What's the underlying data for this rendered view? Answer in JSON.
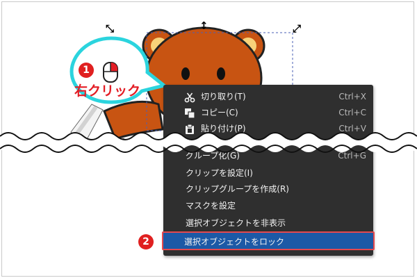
{
  "annotation": {
    "step1": "1",
    "step1_label": "右クリック",
    "step2": "2",
    "mouse_icon": "mouse-right-click-icon"
  },
  "colors": {
    "menu_bg": "#2f2f2f",
    "highlight": "#1c59a6",
    "accent_red": "#e31c24",
    "callout_cyan": "#2bd4de",
    "bear_brown": "#c85412"
  },
  "menu": {
    "items": [
      {
        "label": "切り取り(T)",
        "shortcut": "Ctrl+X",
        "icon": "scissors-icon"
      },
      {
        "label": "コピー(C)",
        "shortcut": "Ctrl+C",
        "icon": "copy-icon"
      },
      {
        "label": "貼り付け(P)",
        "shortcut": "Ctrl+V",
        "icon": "paste-icon"
      },
      {
        "label": "グループ化(G)",
        "shortcut": "Ctrl+G"
      },
      {
        "label": "クリップを設定(I)"
      },
      {
        "label": "クリップグループを作成(R)"
      },
      {
        "label": "マスクを設定"
      },
      {
        "label": "選択オブジェクトを非表示"
      },
      {
        "label": "選択オブジェクトをロック",
        "selected": true
      }
    ]
  }
}
